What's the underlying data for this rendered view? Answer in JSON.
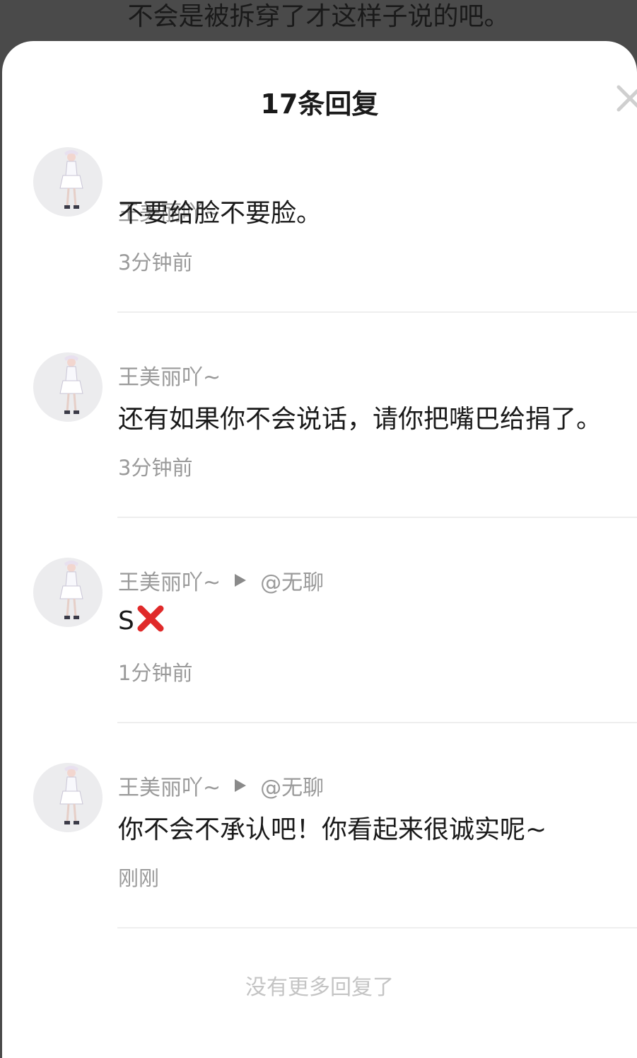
{
  "background_comment": "不会是被拆穿了才这样子说的吧。",
  "sheet": {
    "title": "17条回复",
    "close_icon": "close-icon"
  },
  "replies": [
    {
      "username": "王美丽吖~",
      "reply_to": "",
      "text": "不要给脸不要脸。",
      "time": "3分钟前"
    },
    {
      "username": "王美丽吖~",
      "reply_to": "",
      "text": "还有如果你不会说话，请你把嘴巴给捐了。",
      "time": "3分钟前"
    },
    {
      "username": "王美丽吖~",
      "reply_to": "@无聊",
      "text": "S",
      "emoji": "cross-mark-emoji",
      "time": "1分钟前"
    },
    {
      "username": "王美丽吖~",
      "reply_to": "@无聊",
      "text": "你不会不承认吧！你看起来很诚实呢~",
      "time": "刚刚"
    }
  ],
  "footer": "没有更多回复了",
  "colors": {
    "overlay": "#4a4a4a",
    "sheet_bg": "#ffffff",
    "secondary_text": "#9a9a9a",
    "footer_text": "#c4c4c4",
    "emoji_red": "#e02a2a"
  }
}
